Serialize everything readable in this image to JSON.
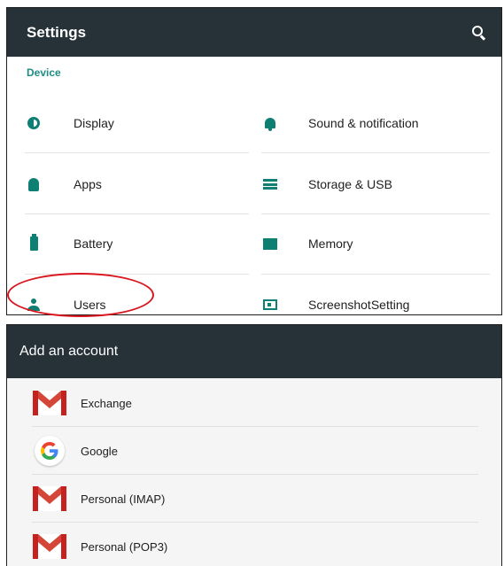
{
  "settings": {
    "title": "Settings",
    "section": "Device",
    "items": [
      {
        "label": "Display",
        "icon": "display-icon"
      },
      {
        "label": "Sound & notification",
        "icon": "bell-icon"
      },
      {
        "label": "Apps",
        "icon": "android-icon"
      },
      {
        "label": "Storage & USB",
        "icon": "storage-icon"
      },
      {
        "label": "Battery",
        "icon": "battery-icon"
      },
      {
        "label": "Memory",
        "icon": "memory-icon"
      },
      {
        "label": "Users",
        "icon": "person-icon"
      },
      {
        "label": "ScreenshotSetting",
        "icon": "screenshot-icon"
      }
    ]
  },
  "account": {
    "title": "Add an account",
    "items": [
      {
        "label": "Exchange",
        "icon": "gmail-icon"
      },
      {
        "label": "Google",
        "icon": "google-icon"
      },
      {
        "label": "Personal (IMAP)",
        "icon": "gmail-icon"
      },
      {
        "label": "Personal (POP3)",
        "icon": "gmail-icon"
      }
    ]
  },
  "colors": {
    "appbar": "#263238",
    "accent": "#0e7f73",
    "section_label": "#1e8c84",
    "highlight": "#d9151f"
  }
}
